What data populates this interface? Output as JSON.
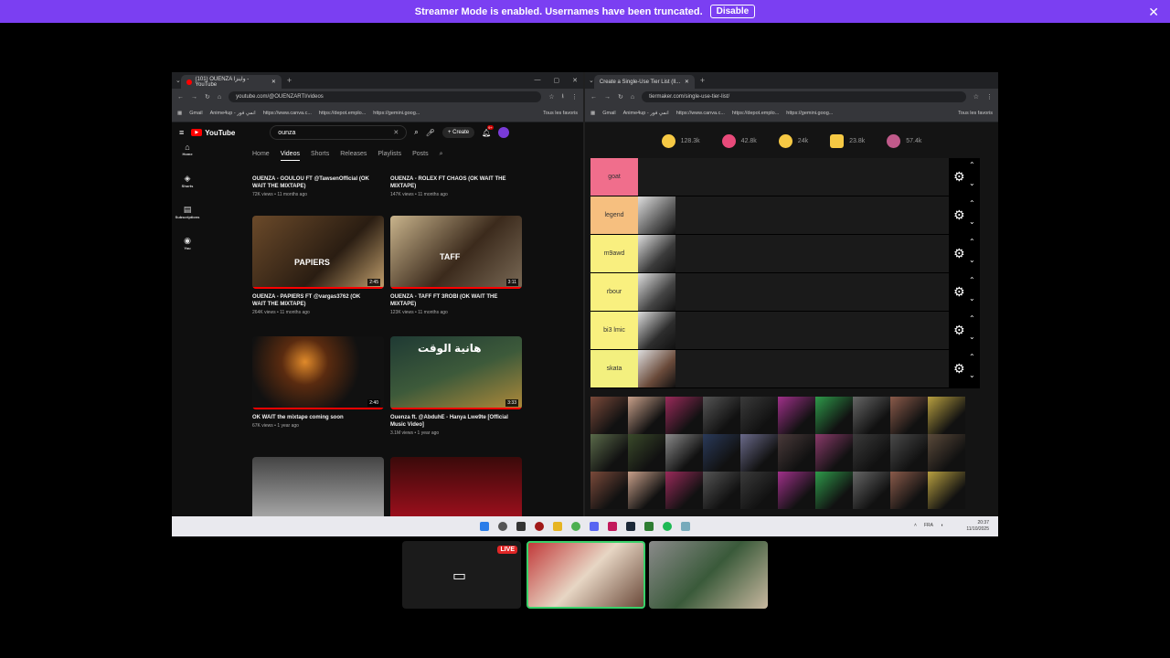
{
  "banner": {
    "text": "Streamer Mode is enabled. Usernames have been truncated.",
    "button": "Disable"
  },
  "left_browser": {
    "tab_title": "(101) OUENZA واينزا - YouTube",
    "url": "youtube.com/@OUENZARTI/videos",
    "bookmarks": [
      "Gmail",
      "Anime4up - انمي فور",
      "https://www.canva.c...",
      "https://depot.emplo...",
      "https://gemini.goog...",
      "Tous les favoris"
    ]
  },
  "youtube": {
    "logo": "YouTube",
    "search_value": "ounza",
    "create_label": "Create",
    "notifications": "9+",
    "nav": [
      "Home",
      "Shorts",
      "Subscriptions",
      "You"
    ],
    "tabs": [
      "Home",
      "Videos",
      "Shorts",
      "Releases",
      "Playlists",
      "Posts"
    ],
    "videos": [
      {
        "title": "OUENZA - GOULOU FT @TawsenOfficial (OK WAIT THE MIXTAPE)",
        "meta": "72K views • 11 months ago",
        "duration": ""
      },
      {
        "title": "OUENZA - ROLEX FT CHAOS (OK WAIT THE MIXTAPE)",
        "meta": "147K views • 11 months ago",
        "duration": ""
      },
      {
        "title": "OUENZA - PAPIERS FT @vargas3762 (OK WAIT THE MIXTAPE)",
        "meta": "264K views • 11 months ago",
        "duration": "2:45"
      },
      {
        "title": "OUENZA - TAFF FT 3ROBI (OK WAIT THE MIXTAPE)",
        "meta": "123K views • 11 months ago",
        "duration": "3:11"
      },
      {
        "title": "OK WAIT the mixtape coming soon",
        "meta": "67K views • 1 year ago",
        "duration": "2:40"
      },
      {
        "title": "Ouenza ft. @AbduhE - Hanya Lwe9te [Official Music Video]",
        "meta": "3.1M views • 1 year ago",
        "duration": "3:33"
      }
    ],
    "thumb_text": {
      "papiers": "PAPIERS",
      "taff": "TAFF",
      "hanya": "هانية الوقت"
    }
  },
  "right_browser": {
    "tab_title": "Create a Single-Use Tier List (Il...",
    "url": "tiermaker.com/single-use-tier-list/",
    "bookmarks": [
      "Gmail",
      "Anime4up - انمي فور",
      "https://www.canva.c...",
      "https://depot.emplo...",
      "https://gemini.goog...",
      "Tous les favoris"
    ]
  },
  "tiermaker": {
    "reactions": [
      {
        "icon": "smile-icon",
        "count": "128.3k"
      },
      {
        "icon": "heart-eyes-icon",
        "count": "42.8k"
      },
      {
        "icon": "laugh-icon",
        "count": "24k"
      },
      {
        "icon": "hands-icon",
        "count": "23.8k"
      },
      {
        "icon": "poop-icon",
        "count": "57.4k"
      }
    ],
    "tiers": [
      {
        "label": "goat",
        "color": "#f06e8c",
        "has_item": false
      },
      {
        "label": "legend",
        "color": "#f6bf7f",
        "has_item": true
      },
      {
        "label": "m9awd",
        "color": "#f9ef7f",
        "has_item": true
      },
      {
        "label": "rbour",
        "color": "#f9f07f",
        "has_item": true
      },
      {
        "label": "bi3 lmic",
        "color": "#f9f07f",
        "has_item": true
      },
      {
        "label": "skata",
        "color": "#f3f07f",
        "has_item": true
      }
    ],
    "pool_count": 30
  },
  "taskbar": {
    "lang": "FRA",
    "time": "20:37",
    "date": "11/10/2025"
  },
  "stream": {
    "live_label": "LIVE"
  }
}
